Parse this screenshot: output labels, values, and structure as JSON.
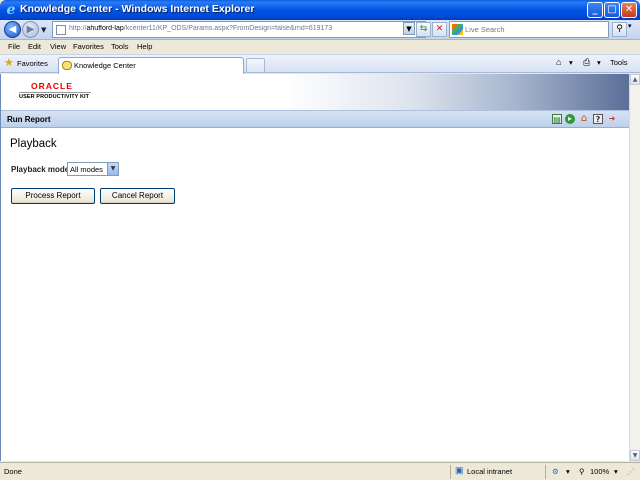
{
  "window": {
    "title": "Knowledge Center - Windows Internet Explorer",
    "buttons": {
      "minimize": "_",
      "maximize": "□",
      "close": "✕"
    }
  },
  "nav": {
    "url_prefix": "http://",
    "url_host": "ahufford-lap",
    "url_path": "/kcenter11/KP_ODS/Params.aspx?FromDesign=false&rnd=619173",
    "search_placeholder": "Live Search"
  },
  "menu": [
    "File",
    "Edit",
    "View",
    "Favorites",
    "Tools",
    "Help"
  ],
  "tabs": {
    "favorites_label": "Favorites",
    "active_tab": "Knowledge Center",
    "tools_label": "Tools"
  },
  "page": {
    "logo_brand": "ORACLE",
    "logo_product": "USER PRODUCTIVITY KIT",
    "section_title": "Run Report",
    "heading": "Playback",
    "mode_label": "Playback mode",
    "mode_value": "All modes",
    "process_button": "Process Report",
    "cancel_button": "Cancel Report"
  },
  "status": {
    "text": "Done",
    "zone": "Local intranet",
    "zoom": "100%"
  }
}
